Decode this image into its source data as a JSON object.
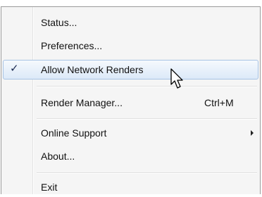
{
  "menu": {
    "items": [
      {
        "label": "Status..."
      },
      {
        "label": "Preferences..."
      },
      {
        "label": "Allow Network Renders",
        "checked": true,
        "check_glyph": "✓"
      },
      {
        "label": "Render Manager...",
        "shortcut": "Ctrl+M"
      },
      {
        "label": "Online Support",
        "has_submenu": true
      },
      {
        "label": "About..."
      },
      {
        "label": "Exit"
      }
    ]
  },
  "colors": {
    "menu_background": "#f5f5f5",
    "hover_border": "#a7c3e4",
    "text": "#111111"
  }
}
